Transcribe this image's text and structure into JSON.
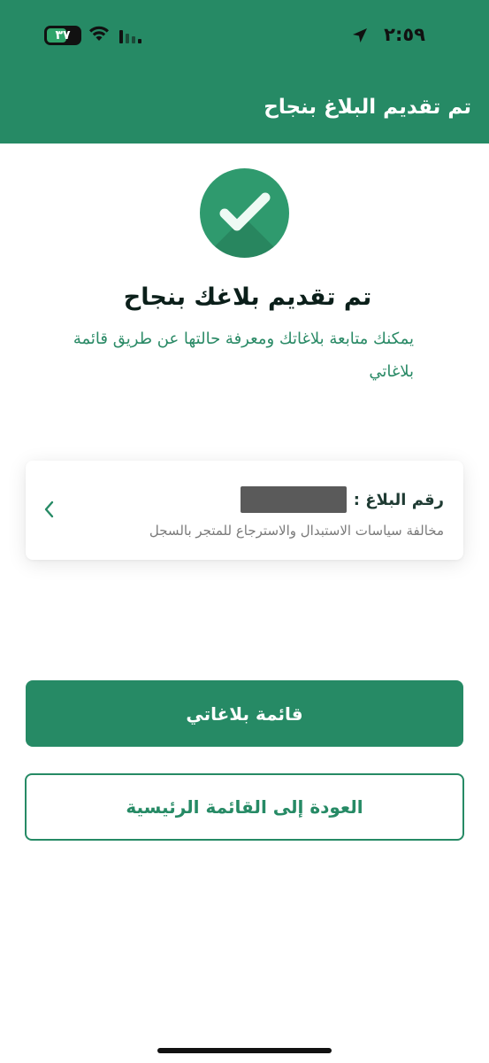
{
  "status_bar": {
    "time": "٢:٥٩",
    "battery": "٣٧",
    "icons": [
      "location-arrow-icon",
      "wifi-icon",
      "signal-icon",
      "battery-icon"
    ]
  },
  "header": {
    "title": "تم تقديم البلاغ بنجاح"
  },
  "success": {
    "icon": "check-circle-icon",
    "title": "تم تقديم بلاغك بنجاح",
    "description": "يمكنك متابعة بلاغاتك ومعرفة حالتها عن طريق قائمة بلاغاتي"
  },
  "report_card": {
    "number_label": "رقم البلاغ :",
    "description": "مخالفة سياسات الاستبدال والاسترجاع للمتجر بالسجل",
    "chevron_icon": "chevron-left-icon"
  },
  "actions": {
    "primary_label": "قائمة بلاغاتي",
    "secondary_label": "العودة إلى القائمة الرئيسية"
  },
  "colors": {
    "brand": "#268a65",
    "text_dark": "#0b1f1a",
    "muted": "#7a7a7a"
  }
}
